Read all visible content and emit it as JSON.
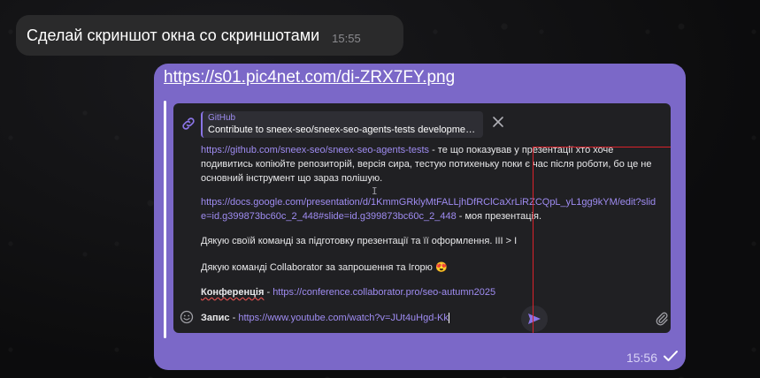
{
  "incoming": {
    "text": "Сделай скриншот окна со скриншотами",
    "time": "15:55"
  },
  "outgoing": {
    "link": "https://s01.pic4net.com/di-ZRX7FY.png",
    "time": "15:56"
  },
  "screenshot": {
    "quote_site": "GitHub",
    "quote_title": "Contribute to sneex-seo/sneex-seo-agents-tests development by …",
    "line1_link": "https://github.com/sneex-seo/sneex-seo-agents-tests",
    "line1_text": " - те що показував у презентації хто хоче подивитись копіюйте репозиторій, версія сира, тестую потихеньку поки є час після роботи, бо це не основний інструмент що зараз полішую.",
    "line2_link": "https://docs.google.com/presentation/d/1KmmGRklyMtFALLjhDfRClCaXrLiRZCQpL_yL1gg9kYM/edit?slide=id.g399873bc60c_2_448#slide=id.g399873bc60c_2_448",
    "line2_text": " - моя презентація.",
    "line3_text": "Дякую своїй команді за підготовку презентації та її оформлення. III > I",
    "line4_text": "Дякую команді Collaborator за запрошення та Ігорю 😍",
    "line5_label": "Конференція",
    "line5_sep": " - ",
    "line5_link": "https://conference.collaborator.pro/seo-autumn2025",
    "input_label": "Запис",
    "input_sep": " - ",
    "input_link": "https://www.youtube.com/watch?v=JUt4uHgd-Kk"
  },
  "colors": {
    "bubble_out": "#7b68c8",
    "bubble_in": "#2a2a2b",
    "link_in_screenshot": "#9f8cf2",
    "highlight": "#d9222b"
  },
  "icons": {
    "link": "link-chain-icon",
    "close": "close-icon",
    "emoji": "emoji-icon",
    "send": "send-icon",
    "attach": "paperclip-icon",
    "read": "double-check-icon"
  }
}
